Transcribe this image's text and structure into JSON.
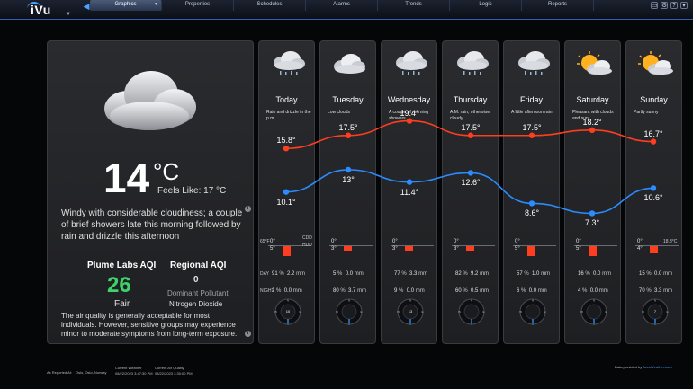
{
  "app": {
    "logo": "iVu"
  },
  "nav": {
    "tabs": [
      "Graphics",
      "Properties",
      "Schedules",
      "Alarms",
      "Trends",
      "Logic",
      "Reports"
    ]
  },
  "icons": {
    "back": "back-arrow-icon",
    "window": [
      "display-icon",
      "settings-icon",
      "help-icon",
      "menu-icon"
    ]
  },
  "colors": {
    "accent": "#2e5fb0",
    "high_temp": "#ff3d1f",
    "low_temp": "#2b8cff",
    "aqi_good": "#3fd26b",
    "precip": "#ff3d1f"
  },
  "current": {
    "temperature": "14",
    "unit": "°C",
    "feels_like": "Feels Like: 17 °C",
    "description": "Windy with considerable cloudiness; a couple of brief showers late this morning followed by rain and drizzle this afternoon",
    "aqi": {
      "title": "Plume Labs AQI",
      "value": "26",
      "level": "Fair",
      "regional_title": "Regional AQI",
      "regional_value": "0",
      "pollutant_label": "Dominant Pollutant",
      "pollutant": "Nitrogen Dioxide",
      "description": "The air quality is generally acceptable for most individuals. However, sensitive groups may experience minor to moderate symptoms from long-term exposure."
    }
  },
  "side_labels": {
    "left_temp": "65°F",
    "cdd": "CDD",
    "hdd": "HDD",
    "right_temp": "18.3°C",
    "day": "DAY",
    "night": "NIGHT"
  },
  "forecast": [
    {
      "name": "Today",
      "desc": "Rain and drizzle in the p.m.",
      "high": "15.8°",
      "low": "10.1°",
      "hi_v": 15.8,
      "lo_v": 10.1,
      "p_top": "0°",
      "p_bot": "5°",
      "p_bar": 0.9,
      "day_pct": "91",
      "day_amt": "2.2",
      "night_pct": "2",
      "night_amt": "0.0",
      "unit_pct": "%",
      "unit_mm": "mm",
      "wind": "10",
      "icon": "rain-cloud-icon"
    },
    {
      "name": "Tuesday",
      "desc": "Low clouds",
      "high": "17.5°",
      "low": "13°",
      "hi_v": 17.5,
      "lo_v": 13.0,
      "p_top": "0°",
      "p_bot": "3°",
      "p_bar": 0.45,
      "day_pct": "5",
      "day_amt": "0.0",
      "night_pct": "80",
      "night_amt": "3.7",
      "unit_pct": "%",
      "unit_mm": "mm",
      "wind": "",
      "icon": "cloud-icon"
    },
    {
      "name": "Wednesday",
      "desc": "A couple of morning showers",
      "high": "19.4°",
      "low": "11.4°",
      "hi_v": 19.4,
      "lo_v": 11.4,
      "p_top": "0°",
      "p_bot": "3°",
      "p_bar": 0.45,
      "day_pct": "77",
      "day_amt": "3.3",
      "night_pct": "9",
      "night_amt": "0.0",
      "unit_pct": "%",
      "unit_mm": "mm",
      "wind": "13",
      "icon": "rain-cloud-icon"
    },
    {
      "name": "Thursday",
      "desc": "A.M. rain; otherwise, cloudy",
      "high": "17.5°",
      "low": "12.6°",
      "hi_v": 17.5,
      "lo_v": 12.6,
      "p_top": "0°",
      "p_bot": "3°",
      "p_bar": 0.45,
      "day_pct": "82",
      "day_amt": "9.2",
      "night_pct": "60",
      "night_amt": "0.5",
      "unit_pct": "%",
      "unit_mm": "mm",
      "wind": "",
      "icon": "rain-cloud-icon"
    },
    {
      "name": "Friday",
      "desc": "A little afternoon rain",
      "high": "17.5°",
      "low": "8.6°",
      "hi_v": 17.5,
      "lo_v": 8.6,
      "p_top": "0°",
      "p_bot": "5°",
      "p_bar": 0.9,
      "day_pct": "57",
      "day_amt": "1.0",
      "night_pct": "6",
      "night_amt": "0.0",
      "unit_pct": "%",
      "unit_mm": "mm",
      "wind": "",
      "icon": "rain-cloud-icon"
    },
    {
      "name": "Saturday",
      "desc": "Pleasant with clouds and sun",
      "high": "18.2°",
      "low": "7.3°",
      "hi_v": 18.2,
      "lo_v": 7.3,
      "p_top": "0°",
      "p_bot": "5°",
      "p_bar": 0.9,
      "day_pct": "16",
      "day_amt": "0.0",
      "night_pct": "4",
      "night_amt": "0.0",
      "unit_pct": "%",
      "unit_mm": "mm",
      "wind": "",
      "icon": "partly-sunny-icon"
    },
    {
      "name": "Sunday",
      "desc": "Partly sunny",
      "high": "16.7°",
      "low": "10.6°",
      "hi_v": 16.7,
      "lo_v": 10.6,
      "p_top": "0°",
      "p_bot": "4°",
      "p_bar": 0.7,
      "day_pct": "15",
      "day_amt": "0.0",
      "night_pct": "70",
      "night_amt": "3.3",
      "unit_pct": "%",
      "unit_mm": "mm",
      "wind": "7",
      "icon": "partly-sunny-icon"
    }
  ],
  "footer": {
    "reported_label": "As Reported At:",
    "location": "Oslo, Oslo, Norway",
    "current_weather_label": "Current Weather",
    "current_weather_time": "08/22/2023 3:47:30 PM",
    "air_quality_label": "Current Air Quality",
    "air_quality_time": "08/22/2023 3:30:00 PM",
    "credit_prefix": "Data provided by",
    "credit_brand": "AccuWeather.com"
  }
}
